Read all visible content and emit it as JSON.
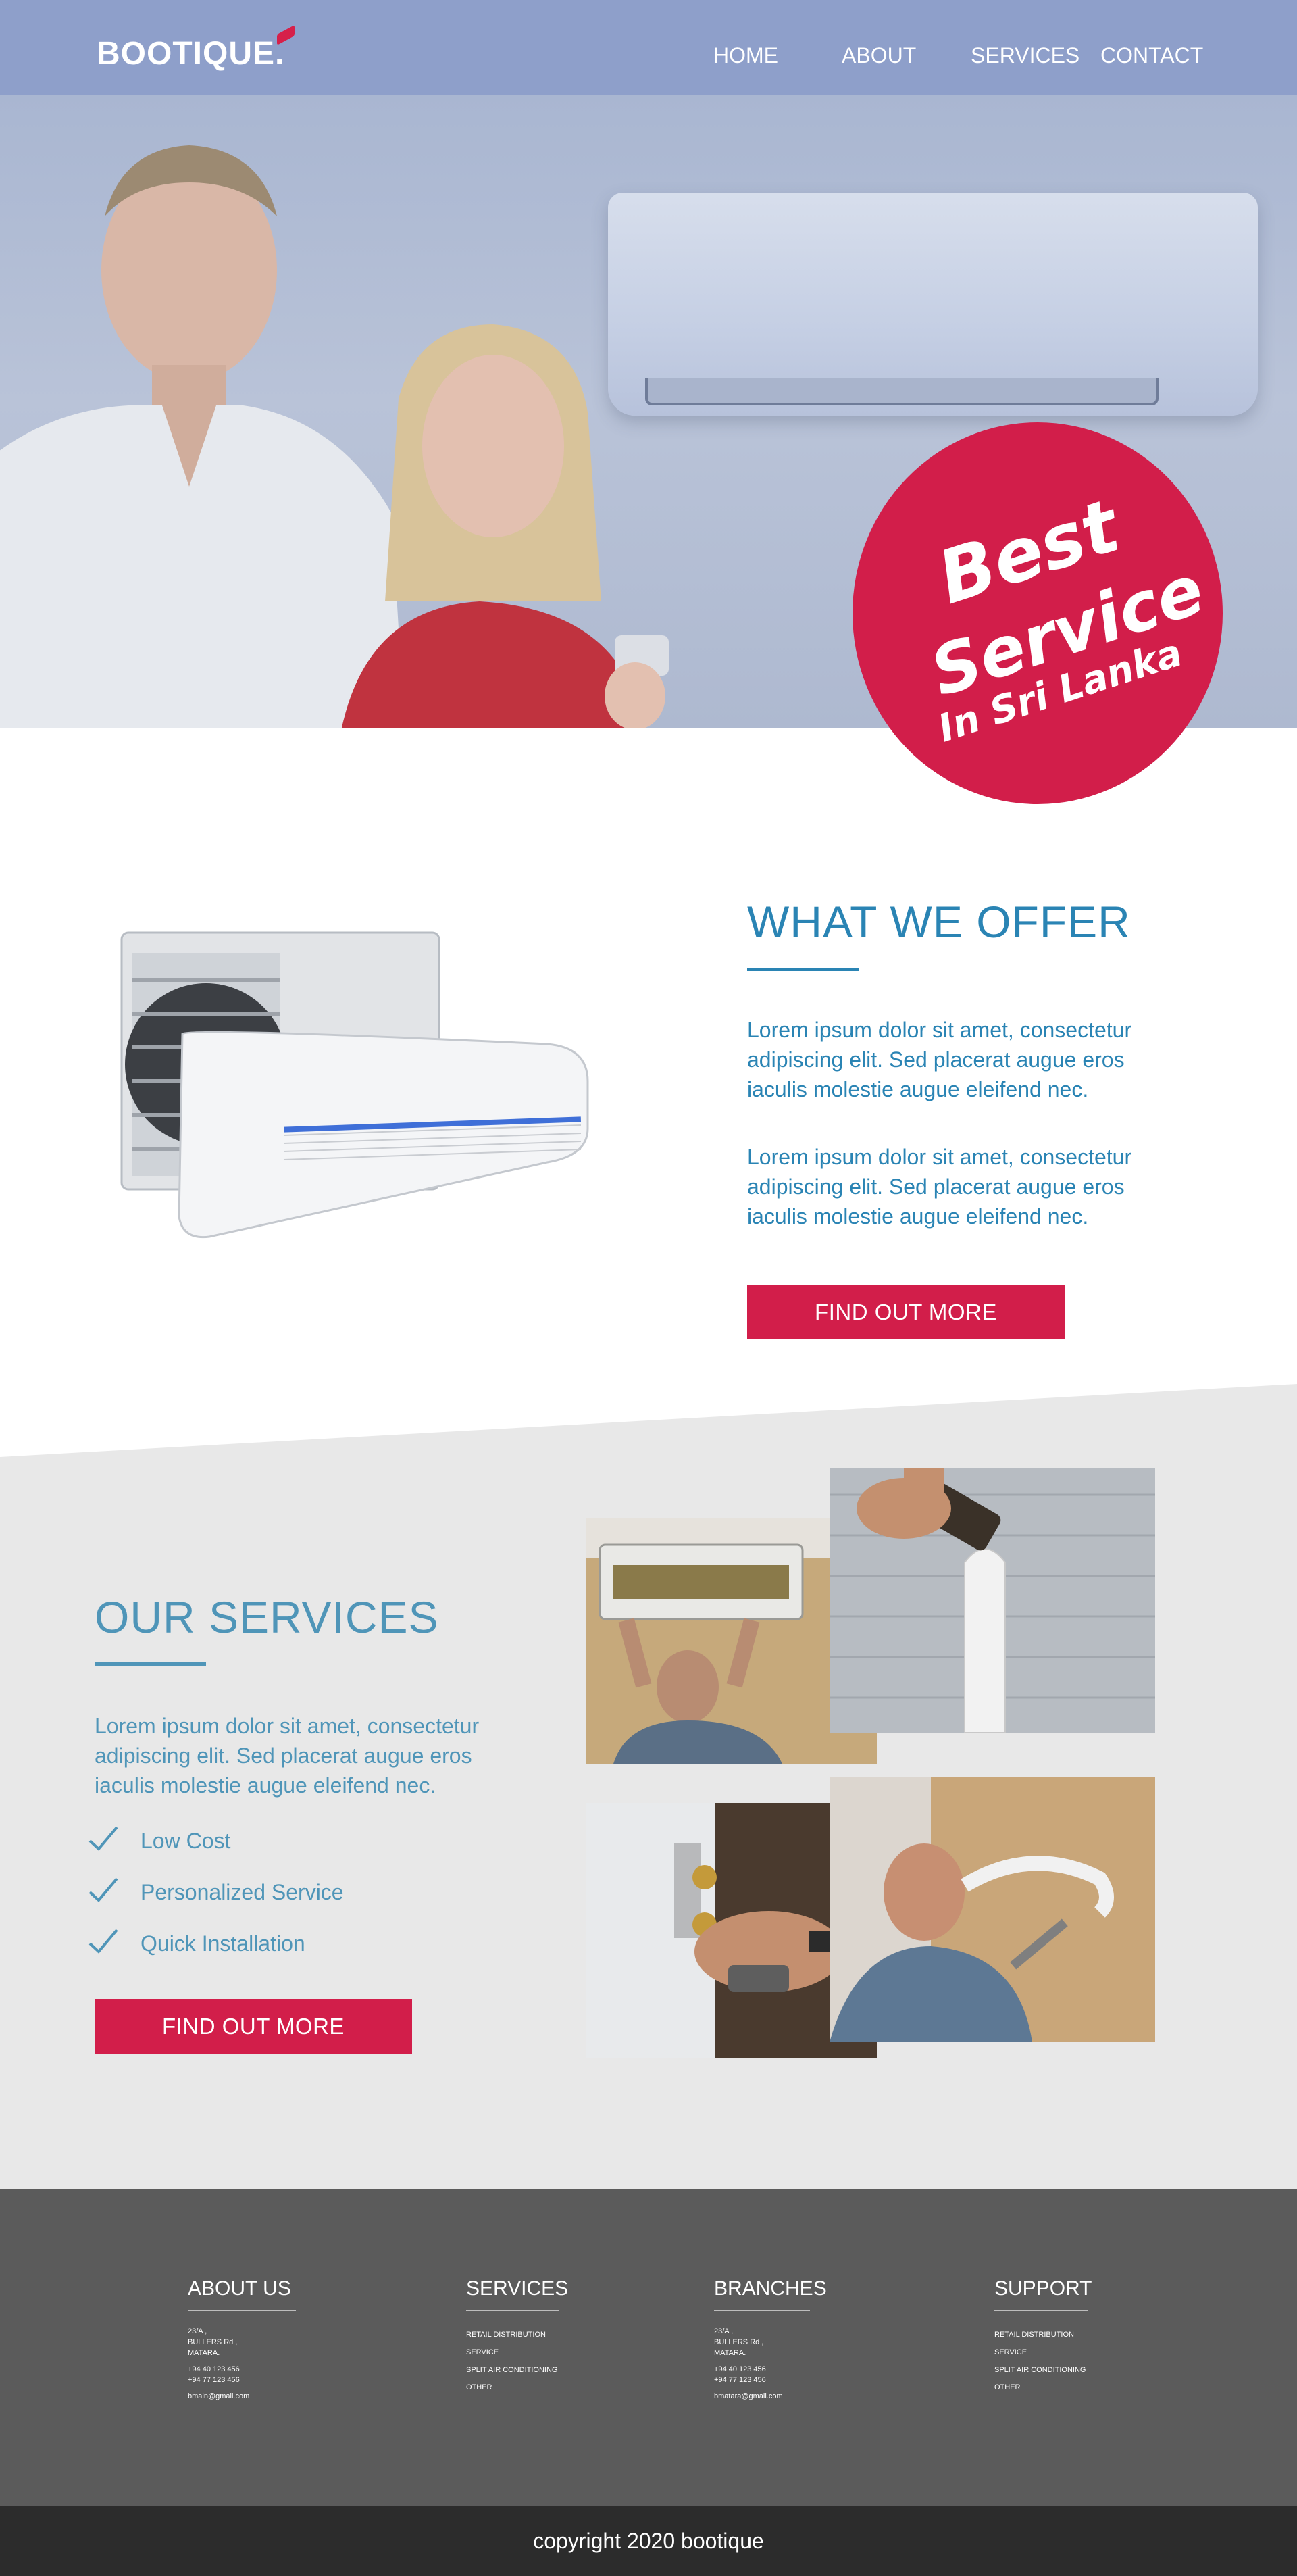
{
  "nav": {
    "logo": "BOOTIQUE.",
    "links": [
      "HOME",
      "ABOUT",
      "SERVICES",
      "CONTACT"
    ]
  },
  "hero": {
    "badge_line1": "Best",
    "badge_line2": "Service",
    "badge_line3": "In Sri Lanka"
  },
  "offer": {
    "title": "WHAT WE OFFER",
    "paragraph1": "Lorem ipsum dolor sit amet, consectetur adipiscing elit. Sed placerat augue eros iaculis molestie augue eleifend nec.",
    "paragraph2": "Lorem ipsum dolor sit amet, consectetur adipiscing elit. Sed placerat augue eros iaculis molestie augue eleifend nec.",
    "button": "FIND OUT MORE"
  },
  "services": {
    "title": "OUR SERVICES",
    "paragraph": "Lorem ipsum dolor sit amet, consectetur adipiscing elit. Sed placerat augue eros iaculis molestie augue eleifend nec.",
    "features": [
      "Low Cost",
      "Personalized Service",
      "Quick Installation"
    ],
    "button": "FIND OUT MORE"
  },
  "footer": {
    "about": {
      "heading": "ABOUT US",
      "address": [
        "23/A ,",
        "BULLERS Rd ,",
        "MATARA."
      ],
      "phones": [
        "+94 40 123 456",
        "+94 77 123 456"
      ],
      "email": "bmain@gmail.com"
    },
    "services": {
      "heading": "SERVICES",
      "items": [
        "RETAIL DISTRIBUTION",
        "SERVICE",
        "SPLIT AIR CONDITIONING",
        "OTHER"
      ]
    },
    "branches": {
      "heading": "BRANCHES",
      "address": [
        "23/A ,",
        "BULLERS Rd ,",
        "MATARA."
      ],
      "phones": [
        "+94 40 123 456",
        "+94 77 123 456"
      ],
      "email": "bmatara@gmail.com"
    },
    "support": {
      "heading": "SUPPORT",
      "items": [
        "RETAIL DISTRIBUTION",
        "SERVICE",
        "SPLIT AIR CONDITIONING",
        "OTHER"
      ]
    }
  },
  "copyright": "copyright 2020 bootique",
  "colors": {
    "accent": "#d21e4a",
    "primary_blue": "#2a84b4",
    "nav_bg": "#8e9fca",
    "footer_bg": "#5b5b5b",
    "copyright_bg": "#2c2c2c"
  }
}
